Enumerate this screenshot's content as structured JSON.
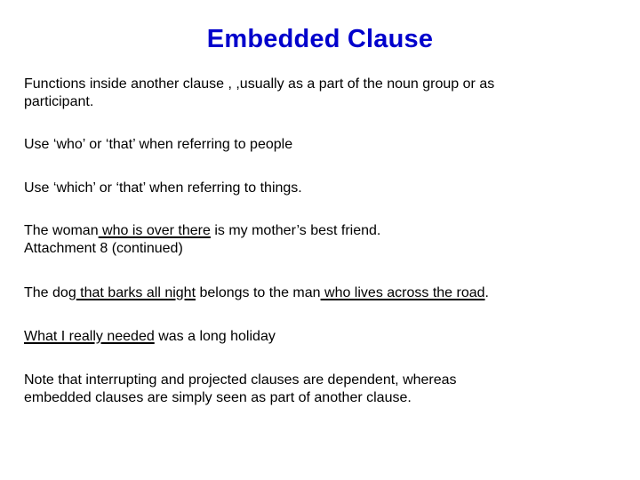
{
  "slide": {
    "title": "Embedded Clause",
    "definition_line1": "Functions inside another clause , ,usually as a part of the noun group or as",
    "definition_line2": "participant.",
    "rule_who": "Use ‘who’ or ‘that’ when referring to people",
    "rule_which": "Use ‘which’ or ‘that’ when referring to things.",
    "example1": {
      "pre": "The woman",
      "underlined": " who is over there",
      "post": " is my mother’s best friend."
    },
    "attachment_note": "Attachment 8 (continued)",
    "example2": {
      "pre": "The dog",
      "underlined1": " that barks all night",
      "mid": " belongs to the man",
      "underlined2": " who lives across the road",
      "post": "."
    },
    "example3": {
      "underlined": "What I really needed",
      "post": " was a long holiday"
    },
    "note_line1": "Note that interrupting and projected clauses are dependent, whereas",
    "note_line2": "embedded clauses are simply seen as part of another clause."
  }
}
